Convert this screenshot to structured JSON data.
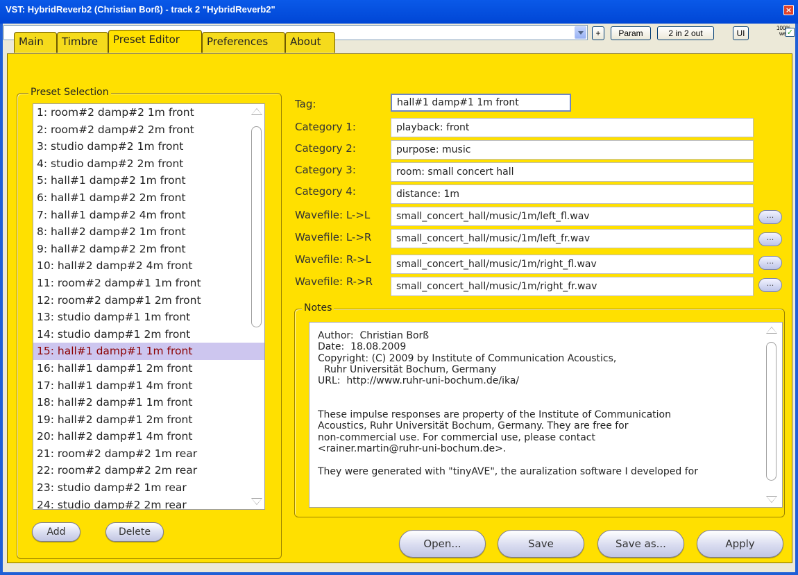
{
  "window": {
    "title": "VST: HybridReverb2 (Christian Borß) - track 2 \"HybridReverb2\"",
    "close": "×"
  },
  "toolbar": {
    "plus": "+",
    "param": "Param",
    "io": "2 in 2 out",
    "ui": "UI",
    "wet_top": "100%",
    "wet_bottom": "wet",
    "check": "✓"
  },
  "tabs": [
    "Main",
    "Timbre",
    "Preset Editor",
    "Preferences",
    "About"
  ],
  "preset_selection": {
    "legend": "Preset Selection",
    "items": [
      "1: room#2 damp#2 1m front",
      "2: room#2 damp#2 2m front",
      "3: studio damp#2 1m front",
      "4: studio damp#2 2m front",
      "5: hall#1 damp#2 1m front",
      "6: hall#1 damp#2 2m front",
      "7: hall#1 damp#2 4m front",
      "8: hall#2 damp#2 1m front",
      "9: hall#2 damp#2 2m front",
      "10: hall#2 damp#2 4m front",
      "11: room#2 damp#1 1m front",
      "12: room#2 damp#1 2m front",
      "13: studio damp#1 1m front",
      "14: studio damp#1 2m front",
      "15: hall#1 damp#1 1m front",
      "16: hall#1 damp#1 2m front",
      "17: hall#1 damp#1 4m front",
      "18: hall#2 damp#1 1m front",
      "19: hall#2 damp#1 2m front",
      "20: hall#2 damp#1 4m front",
      "21: room#2 damp#2 1m rear",
      "22: room#2 damp#2 2m rear",
      "23: studio damp#2 1m rear",
      "24: studio damp#2 2m rear"
    ],
    "add": "Add",
    "delete": "Delete"
  },
  "editor": {
    "tag_label": "Tag:",
    "tag_value": "hall#1 damp#1 1m front",
    "cat1_label": "Category 1:",
    "cat1_value": "playback: front",
    "cat2_label": "Category 2:",
    "cat2_value": "purpose: music",
    "cat3_label": "Category 3:",
    "cat3_value": "room: small concert hall",
    "cat4_label": "Category 4:",
    "cat4_value": "distance: 1m",
    "wll_label": "Wavefile: L->L",
    "wll_value": "small_concert_hall/music/1m/left_fl.wav",
    "wlr_label": "Wavefile: L->R",
    "wlr_value": "small_concert_hall/music/1m/left_fr.wav",
    "wrl_label": "Wavefile: R->L",
    "wrl_value": "small_concert_hall/music/1m/right_fl.wav",
    "wrr_label": "Wavefile: R->R",
    "wrr_value": "small_concert_hall/music/1m/right_fr.wav",
    "browse": "..."
  },
  "notes": {
    "legend": "Notes",
    "lines": [
      "Author:  Christian Borß",
      "Date:  18.08.2009",
      "Copyright: (C) 2009 by Institute of Communication Acoustics,",
      "  Ruhr Universität Bochum, Germany",
      "URL:  http://www.ruhr-uni-bochum.de/ika/",
      "",
      "",
      "These impulse responses are property of the Institute of Communication",
      "Acoustics, Ruhr Universität Bochum, Germany. They are free for",
      "non-commercial use. For commercial use, please contact",
      "<rainer.martin@ruhr-uni-bochum.de>.",
      "",
      "They were generated with \"tinyAVE\", the auralization software I developed for"
    ]
  },
  "actions": {
    "open": "Open...",
    "save": "Save",
    "save_as": "Save as...",
    "apply": "Apply"
  }
}
